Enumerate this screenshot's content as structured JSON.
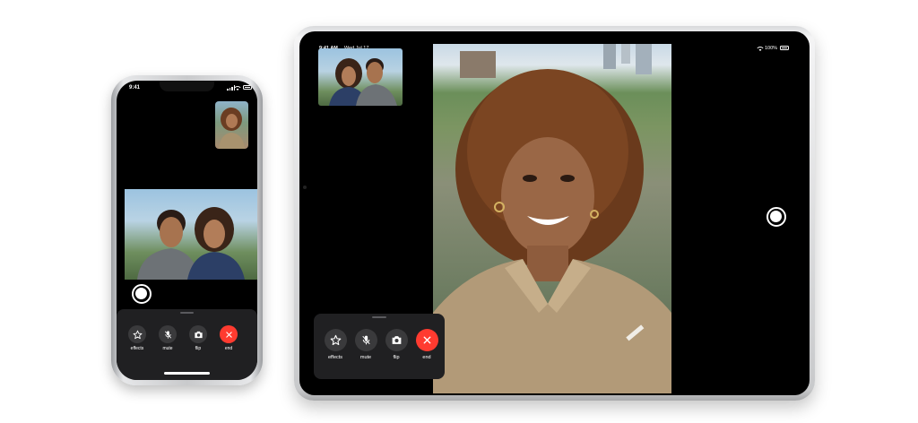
{
  "iphone": {
    "status": {
      "time": "9:41"
    },
    "controls": [
      {
        "label": "effects",
        "icon": "star-icon"
      },
      {
        "label": "mute",
        "icon": "mic-slash-icon"
      },
      {
        "label": "flip",
        "icon": "camera-flip-icon"
      },
      {
        "label": "end",
        "icon": "close-icon"
      }
    ]
  },
  "ipad": {
    "status": {
      "time": "9:41 AM",
      "date": "Wed Jul 17",
      "battery": "100%"
    },
    "controls": [
      {
        "label": "effects",
        "icon": "star-icon"
      },
      {
        "label": "mute",
        "icon": "mic-slash-icon"
      },
      {
        "label": "flip",
        "icon": "camera-flip-icon"
      },
      {
        "label": "end",
        "icon": "close-icon"
      }
    ]
  },
  "colors": {
    "end_call": "#ff3b30",
    "control_bg": "#3a3a3c",
    "panel_bg": "#202022"
  }
}
